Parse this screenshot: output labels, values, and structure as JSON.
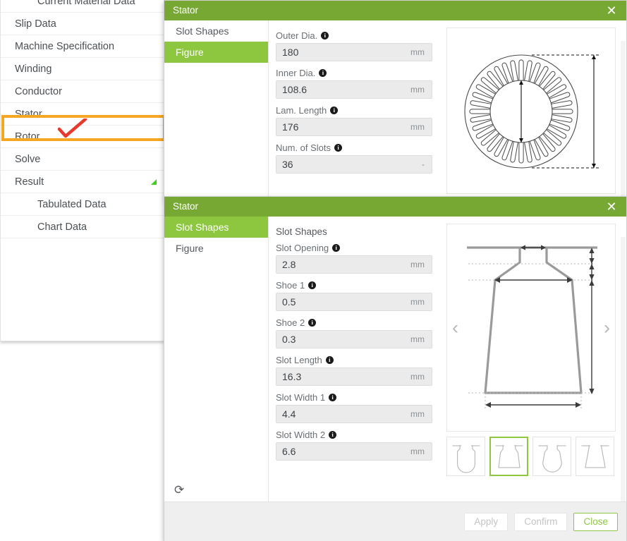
{
  "sidebar": {
    "items": [
      {
        "label": "Current Material Data",
        "sub": true,
        "expand": false
      },
      {
        "label": "Slip Data",
        "sub": false,
        "expand": false
      },
      {
        "label": "Machine Specification",
        "sub": false,
        "expand": false
      },
      {
        "label": "Winding",
        "sub": false,
        "expand": false
      },
      {
        "label": "Conductor",
        "sub": false,
        "expand": false
      },
      {
        "label": "Stator",
        "sub": false,
        "expand": false,
        "highlighted": true
      },
      {
        "label": "Rotor",
        "sub": false,
        "expand": false
      },
      {
        "label": "Solve",
        "sub": false,
        "expand": false
      },
      {
        "label": "Result",
        "sub": false,
        "expand": true
      },
      {
        "label": "Tabulated Data",
        "sub": true,
        "expand": false
      },
      {
        "label": "Chart Data",
        "sub": true,
        "expand": false
      }
    ],
    "annotation": {
      "highlight_color": "#f5a623",
      "checkmark_color": "#e8392e"
    }
  },
  "dialog_figure": {
    "title": "Stator",
    "close_label": "✕",
    "tabs": [
      {
        "label": "Figure",
        "active": true
      },
      {
        "label": "Slot Shapes",
        "active": false
      }
    ],
    "fields": [
      {
        "label": "Outer Dia.",
        "value": "180",
        "unit": "mm",
        "info": "i"
      },
      {
        "label": "Inner Dia.",
        "value": "108.6",
        "unit": "mm",
        "info": "i"
      },
      {
        "label": "Lam. Length",
        "value": "176",
        "unit": "mm",
        "info": "i"
      },
      {
        "label": "Num. of Slots",
        "value": "36",
        "unit": "-",
        "info": "i"
      }
    ],
    "figure_name": "stator-lamination-cross-section"
  },
  "dialog_slot_shapes": {
    "title": "Stator",
    "close_label": "✕",
    "tabs": [
      {
        "label": "Figure",
        "active": false
      },
      {
        "label": "Slot Shapes",
        "active": true
      }
    ],
    "section_title": "Slot Shapes",
    "fields": [
      {
        "label": "Slot Opening",
        "value": "2.8",
        "unit": "mm",
        "info": "i"
      },
      {
        "label": "Shoe 1",
        "value": "0.5",
        "unit": "mm",
        "info": "i"
      },
      {
        "label": "Shoe 2",
        "value": "0.3",
        "unit": "mm",
        "info": "i"
      },
      {
        "label": "Slot Length",
        "value": "16.3",
        "unit": "mm",
        "info": "i"
      },
      {
        "label": "Slot Width 1",
        "value": "4.4",
        "unit": "mm",
        "info": "i"
      },
      {
        "label": "Slot Width 2",
        "value": "6.6",
        "unit": "mm",
        "info": "i"
      }
    ],
    "figure_name": "slot-shape-dimension-drawing",
    "prev_arrow": "‹",
    "next_arrow": "›",
    "thumbnails": [
      {
        "name": "slot-shape-round-bottom-parallel",
        "selected": false
      },
      {
        "name": "slot-shape-trapezoid-flat-bottom",
        "selected": true
      },
      {
        "name": "slot-shape-pear",
        "selected": false
      },
      {
        "name": "slot-shape-tapered-wedge",
        "selected": false
      }
    ],
    "refresh_label": "⟳",
    "footer": {
      "apply_label": "Apply",
      "confirm_label": "Confirm",
      "close_label": "Close"
    }
  },
  "theme": {
    "header_green": "#77a833",
    "accent_green": "#8dc63f",
    "input_fill": "#ebebeb",
    "footer_fill": "#efeff0"
  }
}
